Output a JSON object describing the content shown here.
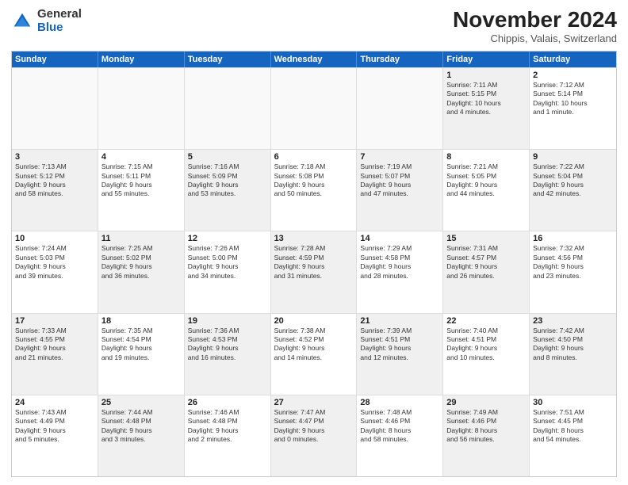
{
  "logo": {
    "general": "General",
    "blue": "Blue"
  },
  "title": "November 2024",
  "subtitle": "Chippis, Valais, Switzerland",
  "days": [
    "Sunday",
    "Monday",
    "Tuesday",
    "Wednesday",
    "Thursday",
    "Friday",
    "Saturday"
  ],
  "weeks": [
    [
      {
        "day": "",
        "info": "",
        "empty": true
      },
      {
        "day": "",
        "info": "",
        "empty": true
      },
      {
        "day": "",
        "info": "",
        "empty": true
      },
      {
        "day": "",
        "info": "",
        "empty": true
      },
      {
        "day": "",
        "info": "",
        "empty": true
      },
      {
        "day": "1",
        "info": "Sunrise: 7:11 AM\nSunset: 5:15 PM\nDaylight: 10 hours\nand 4 minutes.",
        "shaded": true
      },
      {
        "day": "2",
        "info": "Sunrise: 7:12 AM\nSunset: 5:14 PM\nDaylight: 10 hours\nand 1 minute.",
        "shaded": false
      }
    ],
    [
      {
        "day": "3",
        "info": "Sunrise: 7:13 AM\nSunset: 5:12 PM\nDaylight: 9 hours\nand 58 minutes.",
        "shaded": true
      },
      {
        "day": "4",
        "info": "Sunrise: 7:15 AM\nSunset: 5:11 PM\nDaylight: 9 hours\nand 55 minutes.",
        "shaded": false
      },
      {
        "day": "5",
        "info": "Sunrise: 7:16 AM\nSunset: 5:09 PM\nDaylight: 9 hours\nand 53 minutes.",
        "shaded": true
      },
      {
        "day": "6",
        "info": "Sunrise: 7:18 AM\nSunset: 5:08 PM\nDaylight: 9 hours\nand 50 minutes.",
        "shaded": false
      },
      {
        "day": "7",
        "info": "Sunrise: 7:19 AM\nSunset: 5:07 PM\nDaylight: 9 hours\nand 47 minutes.",
        "shaded": true
      },
      {
        "day": "8",
        "info": "Sunrise: 7:21 AM\nSunset: 5:05 PM\nDaylight: 9 hours\nand 44 minutes.",
        "shaded": false
      },
      {
        "day": "9",
        "info": "Sunrise: 7:22 AM\nSunset: 5:04 PM\nDaylight: 9 hours\nand 42 minutes.",
        "shaded": true
      }
    ],
    [
      {
        "day": "10",
        "info": "Sunrise: 7:24 AM\nSunset: 5:03 PM\nDaylight: 9 hours\nand 39 minutes.",
        "shaded": false
      },
      {
        "day": "11",
        "info": "Sunrise: 7:25 AM\nSunset: 5:02 PM\nDaylight: 9 hours\nand 36 minutes.",
        "shaded": true
      },
      {
        "day": "12",
        "info": "Sunrise: 7:26 AM\nSunset: 5:00 PM\nDaylight: 9 hours\nand 34 minutes.",
        "shaded": false
      },
      {
        "day": "13",
        "info": "Sunrise: 7:28 AM\nSunset: 4:59 PM\nDaylight: 9 hours\nand 31 minutes.",
        "shaded": true
      },
      {
        "day": "14",
        "info": "Sunrise: 7:29 AM\nSunset: 4:58 PM\nDaylight: 9 hours\nand 28 minutes.",
        "shaded": false
      },
      {
        "day": "15",
        "info": "Sunrise: 7:31 AM\nSunset: 4:57 PM\nDaylight: 9 hours\nand 26 minutes.",
        "shaded": true
      },
      {
        "day": "16",
        "info": "Sunrise: 7:32 AM\nSunset: 4:56 PM\nDaylight: 9 hours\nand 23 minutes.",
        "shaded": false
      }
    ],
    [
      {
        "day": "17",
        "info": "Sunrise: 7:33 AM\nSunset: 4:55 PM\nDaylight: 9 hours\nand 21 minutes.",
        "shaded": true
      },
      {
        "day": "18",
        "info": "Sunrise: 7:35 AM\nSunset: 4:54 PM\nDaylight: 9 hours\nand 19 minutes.",
        "shaded": false
      },
      {
        "day": "19",
        "info": "Sunrise: 7:36 AM\nSunset: 4:53 PM\nDaylight: 9 hours\nand 16 minutes.",
        "shaded": true
      },
      {
        "day": "20",
        "info": "Sunrise: 7:38 AM\nSunset: 4:52 PM\nDaylight: 9 hours\nand 14 minutes.",
        "shaded": false
      },
      {
        "day": "21",
        "info": "Sunrise: 7:39 AM\nSunset: 4:51 PM\nDaylight: 9 hours\nand 12 minutes.",
        "shaded": true
      },
      {
        "day": "22",
        "info": "Sunrise: 7:40 AM\nSunset: 4:51 PM\nDaylight: 9 hours\nand 10 minutes.",
        "shaded": false
      },
      {
        "day": "23",
        "info": "Sunrise: 7:42 AM\nSunset: 4:50 PM\nDaylight: 9 hours\nand 8 minutes.",
        "shaded": true
      }
    ],
    [
      {
        "day": "24",
        "info": "Sunrise: 7:43 AM\nSunset: 4:49 PM\nDaylight: 9 hours\nand 5 minutes.",
        "shaded": false
      },
      {
        "day": "25",
        "info": "Sunrise: 7:44 AM\nSunset: 4:48 PM\nDaylight: 9 hours\nand 3 minutes.",
        "shaded": true
      },
      {
        "day": "26",
        "info": "Sunrise: 7:46 AM\nSunset: 4:48 PM\nDaylight: 9 hours\nand 2 minutes.",
        "shaded": false
      },
      {
        "day": "27",
        "info": "Sunrise: 7:47 AM\nSunset: 4:47 PM\nDaylight: 9 hours\nand 0 minutes.",
        "shaded": true
      },
      {
        "day": "28",
        "info": "Sunrise: 7:48 AM\nSunset: 4:46 PM\nDaylight: 8 hours\nand 58 minutes.",
        "shaded": false
      },
      {
        "day": "29",
        "info": "Sunrise: 7:49 AM\nSunset: 4:46 PM\nDaylight: 8 hours\nand 56 minutes.",
        "shaded": true
      },
      {
        "day": "30",
        "info": "Sunrise: 7:51 AM\nSunset: 4:45 PM\nDaylight: 8 hours\nand 54 minutes.",
        "shaded": false
      }
    ]
  ]
}
